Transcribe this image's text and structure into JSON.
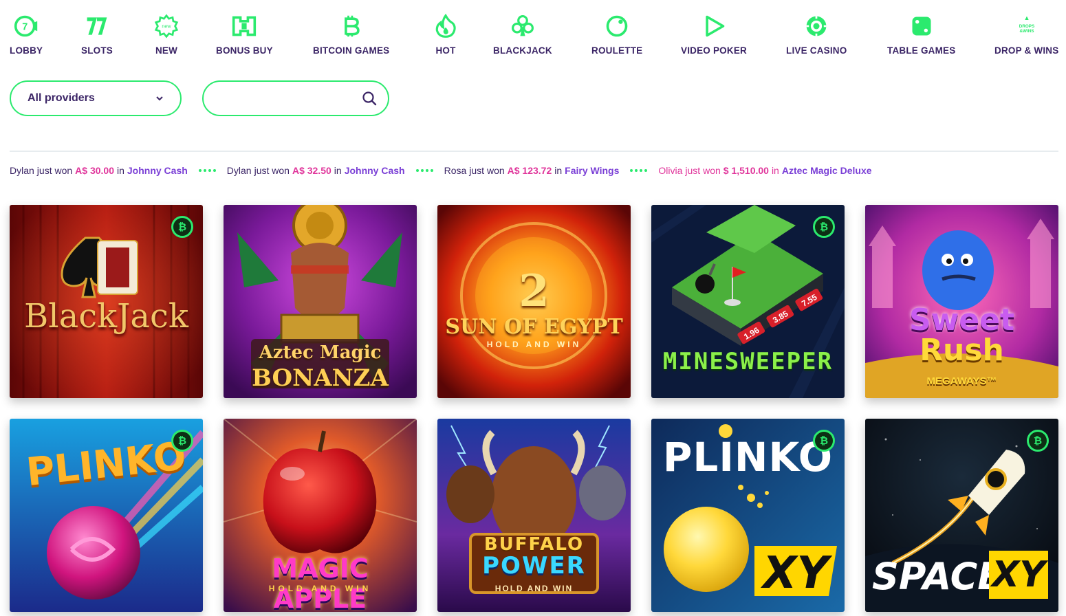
{
  "nav": {
    "items": [
      {
        "label": "LOBBY",
        "icon": "lobby-icon"
      },
      {
        "label": "SLOTS",
        "icon": "slots-icon"
      },
      {
        "label": "NEW",
        "icon": "new-icon"
      },
      {
        "label": "BONUS BUY",
        "icon": "bonus-buy-icon"
      },
      {
        "label": "BITCOIN GAMES",
        "icon": "bitcoin-icon"
      },
      {
        "label": "HOT",
        "icon": "flame-icon"
      },
      {
        "label": "BLACKJACK",
        "icon": "club-icon"
      },
      {
        "label": "ROULETTE",
        "icon": "roulette-icon"
      },
      {
        "label": "VIDEO POKER",
        "icon": "play-icon"
      },
      {
        "label": "LIVE CASINO",
        "icon": "chip-icon"
      },
      {
        "label": "TABLE GAMES",
        "icon": "dice-icon"
      },
      {
        "label": "DROP & WINS",
        "icon": "drops-wins-icon"
      }
    ],
    "new_badge": "new",
    "drops_badge": "DROPS & WINS"
  },
  "filters": {
    "provider_selected": "All providers",
    "search_placeholder": ""
  },
  "ticker": [
    {
      "name": "Dylan",
      "verb": "just won",
      "amount": "A$ 30.00",
      "in": "in",
      "game": "Johnny Cash",
      "highlight": false
    },
    {
      "name": "Dylan",
      "verb": "just won",
      "amount": "A$ 32.50",
      "in": "in",
      "game": "Johnny Cash",
      "highlight": false
    },
    {
      "name": "Rosa",
      "verb": "just won",
      "amount": "A$ 123.72",
      "in": "in",
      "game": "Fairy Wings",
      "highlight": false
    },
    {
      "name": "Olivia",
      "verb": "just won",
      "amount": "$ 1,510.00",
      "in": "in",
      "game": "Aztec Magic Deluxe",
      "highlight": true
    }
  ],
  "games": [
    {
      "title": "BlackJack",
      "bitcoin": true
    },
    {
      "title": "Aztec Magic",
      "title2": "BONANZA",
      "bitcoin": false
    },
    {
      "title": "2",
      "title2": "SUN OF EGYPT",
      "subtitle": "HOLD AND WIN",
      "bitcoin": false
    },
    {
      "title": "MINESWEEPER",
      "multipliers": [
        "1.96",
        "3.85",
        "7.55"
      ],
      "bitcoin": true
    },
    {
      "title": "Sweet",
      "title2": "Rush",
      "subtitle": "MEGAWAYS™",
      "bitcoin": false
    },
    {
      "title": "PLINKO",
      "bitcoin": true
    },
    {
      "title": "MAGIC APPLE",
      "subtitle": "HOLD AND WIN",
      "bitcoin": false
    },
    {
      "title": "BUFFALO",
      "title2": "POWER",
      "subtitle": "HOLD AND WIN",
      "bitcoin": false
    },
    {
      "title": "PLINKO",
      "title2": "XY",
      "bitcoin": true
    },
    {
      "title": "SPACE",
      "title2": "XY",
      "bitcoin": true
    }
  ],
  "bitcoin_symbol": "₿",
  "colors": {
    "accent": "#2bea6e",
    "text": "#3b2566",
    "win_amount": "#e0359b",
    "win_game": "#7a3fd6"
  }
}
